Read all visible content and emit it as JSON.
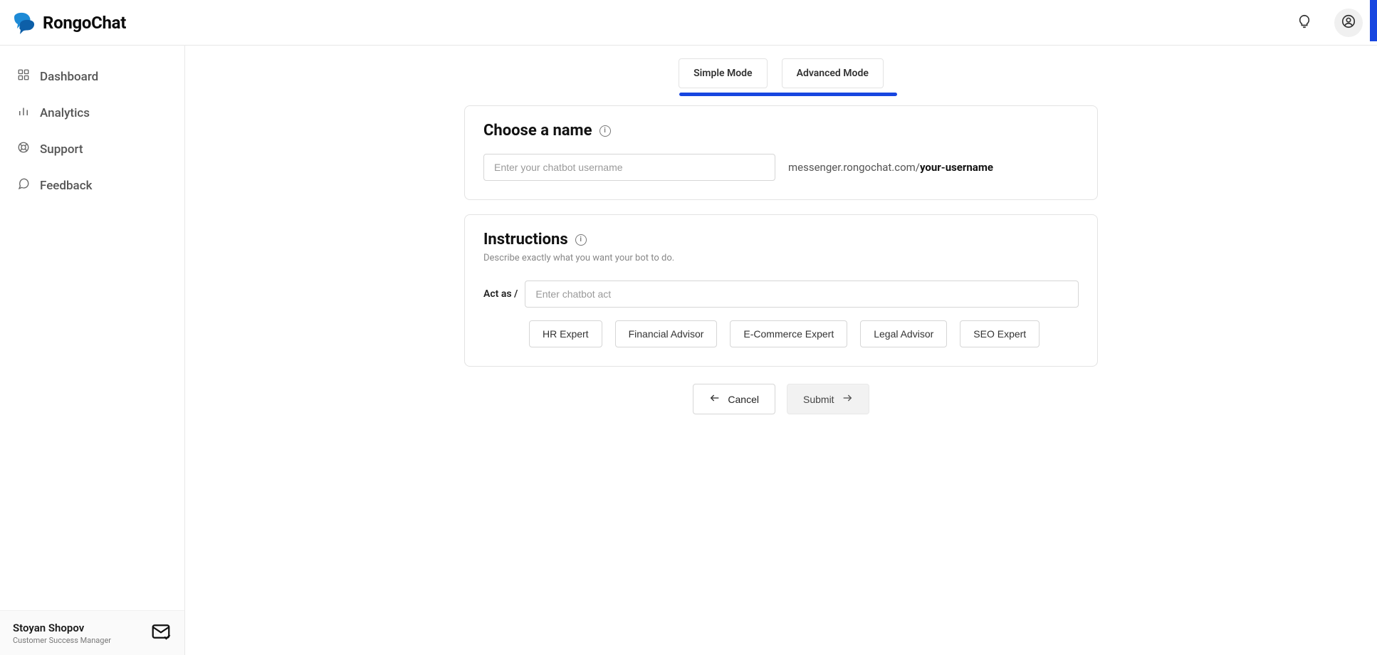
{
  "brand": {
    "name": "RongoChat"
  },
  "header": {
    "hint_icon": "lightbulb-icon",
    "profile_icon": "user-circle-icon"
  },
  "sidebar": {
    "items": [
      {
        "id": "dashboard",
        "label": "Dashboard"
      },
      {
        "id": "analytics",
        "label": "Analytics"
      },
      {
        "id": "support",
        "label": "Support"
      },
      {
        "id": "feedback",
        "label": "Feedback"
      }
    ],
    "footer": {
      "name": "Stoyan Shopov",
      "role": "Customer Success Manager"
    }
  },
  "main": {
    "tabs": [
      {
        "id": "simple",
        "label": "Simple Mode"
      },
      {
        "id": "advanced",
        "label": "Advanced Mode"
      }
    ],
    "name_card": {
      "title": "Choose a name",
      "input_placeholder": "Enter your chatbot username",
      "url_prefix": "messenger.rongochat.com/",
      "url_username": "your-username"
    },
    "instructions_card": {
      "title": "Instructions",
      "description": "Describe exactly what you want your bot to do.",
      "actas_label": "Act as /",
      "actas_placeholder": "Enter chatbot act",
      "suggestions": [
        "HR Expert",
        "Financial Advisor",
        "E-Commerce Expert",
        "Legal Advisor",
        "SEO Expert"
      ]
    },
    "actions": {
      "cancel": "Cancel",
      "submit": "Submit"
    }
  }
}
